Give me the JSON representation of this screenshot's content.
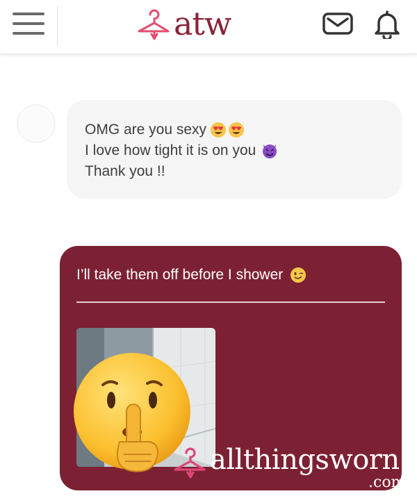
{
  "header": {
    "logo_text": "atw",
    "menu_icon": "hamburger-menu-icon",
    "mail_icon": "mail-icon",
    "bell_icon": "bell-icon"
  },
  "colors": {
    "brand": "#8a2338",
    "bubble_out": "#7c2133",
    "bubble_in": "#f5f5f5"
  },
  "messages": {
    "incoming": {
      "lines": [
        {
          "text": "OMG are you sexy",
          "emoji": [
            "heart-eyes-emoji",
            "heart-eyes-emoji"
          ]
        },
        {
          "text": "I love how tight it is on you",
          "emoji": [
            "smiling-devil-emoji"
          ]
        },
        {
          "text": "Thank you !!",
          "emoji": []
        }
      ]
    },
    "outgoing": {
      "text": "I’ll take them off before I shower",
      "emoji": "winking-face-emoji",
      "attachment": {
        "type": "photo",
        "overlay_emoji": "shushing-face-emoji"
      }
    }
  },
  "watermark": {
    "text": "allthingsworn",
    "suffix": ".com"
  }
}
